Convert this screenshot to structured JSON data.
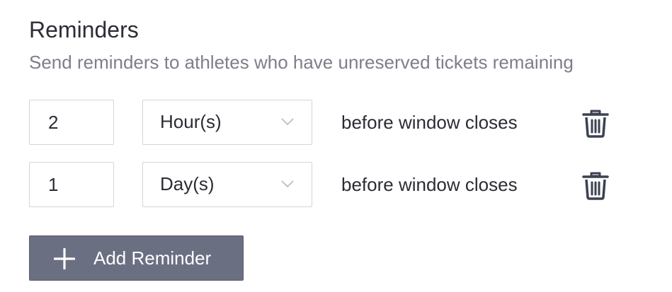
{
  "reminders": {
    "title": "Reminders",
    "subtitle": "Send reminders to athletes who have unreserved tickets remaining",
    "rows": [
      {
        "amount": "2",
        "unit": "Hour(s)",
        "suffix": "before window closes",
        "unit_icon": "chevron-down-icon",
        "delete_icon": "trash-icon"
      },
      {
        "amount": "1",
        "unit": "Day(s)",
        "suffix": "before window closes",
        "unit_icon": "chevron-down-icon",
        "delete_icon": "trash-icon"
      }
    ],
    "add_button": {
      "label": "Add Reminder",
      "icon": "plus-icon"
    }
  },
  "colors": {
    "title": "#2c2e35",
    "subtitle": "#7c7f8b",
    "border": "#d4d5da",
    "button_bg": "#6b6f82",
    "icon": "#3c4152"
  }
}
